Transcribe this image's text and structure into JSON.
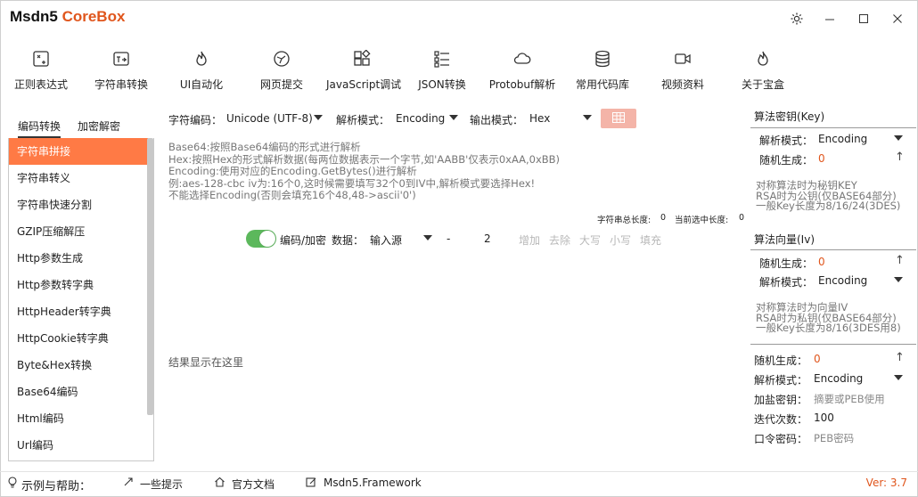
{
  "app": {
    "title_part1": "Msdn5",
    "title_part2": "CoreBox"
  },
  "toolbar": {
    "items": [
      {
        "label": "正则表达式",
        "icon": "regex-icon"
      },
      {
        "label": "字符串转换",
        "icon": "string-convert-icon"
      },
      {
        "label": "UI自动化",
        "icon": "flame-icon"
      },
      {
        "label": "网页提交",
        "icon": "web-submit-icon"
      },
      {
        "label": "JavaScript调试",
        "icon": "blocks-icon"
      },
      {
        "label": "JSON转换",
        "icon": "json-tree-icon"
      },
      {
        "label": "Protobuf解析",
        "icon": "cloud-icon"
      },
      {
        "label": "常用代码库",
        "icon": "database-icon"
      },
      {
        "label": "视频资料",
        "icon": "video-icon"
      },
      {
        "label": "关于宝盒",
        "icon": "flame-icon"
      }
    ]
  },
  "left": {
    "tabs": [
      "编码转换",
      "加密解密"
    ],
    "items": [
      "字符串拼接",
      "字符串转义",
      "字符串快速分割",
      "GZIP压缩解压",
      "Http参数生成",
      "Http参数转字典",
      "HttpHeader转字典",
      "HttpCookie转字典",
      "Byte&Hex转换",
      "Base64编码",
      "Html编码",
      "Url编码"
    ]
  },
  "options": {
    "charset_label": "字符编码：",
    "charset_value": "Unicode (UTF-8)",
    "parse_label": "解析模式：",
    "parse_value": "Encoding",
    "output_label": "输出模式：",
    "output_value": "Hex"
  },
  "hints": [
    "Base64:按照Base64编码的形式进行解析",
    "Hex:按照Hex的形式解析数据(每两位数据表示一个字节,如'AABB'仅表示0xAA,0xBB)",
    "Encoding:使用对应的Encoding.GetBytes()进行解析",
    "例:aes-128-cbc  iv为:16个0,这时候需要填写32个0到IV中,解析模式要选择Hex!",
    "不能选择Encoding(否则会填充16个48,48->ascii'0')"
  ],
  "counters": {
    "total_label": "字符串总长度:",
    "total_value": "0",
    "selected_label": "当前选中长度:",
    "selected_value": "0"
  },
  "data_row": {
    "toggle_label": "编码/加密",
    "data_label": "数据：",
    "source_value": "输入源",
    "dash": "-",
    "count": "2",
    "actions": [
      "增加",
      "去除",
      "大写",
      "小写",
      "填充"
    ]
  },
  "result_placeholder": "结果显示在这里",
  "right": {
    "key_title": "算法密钥(Key)",
    "key_parse_label": "解析模式：",
    "key_parse_value": "Encoding",
    "key_random_label": "随机生成：",
    "key_random_value": "0",
    "key_notes": [
      "对称算法时为秘钥KEY",
      "RSA时为公钥(仅BASE64部分)",
      "一般Key长度为8/16/24(3DES)"
    ],
    "iv_title": "算法向量(Iv)",
    "iv_random_label": "随机生成：",
    "iv_random_value": "0",
    "iv_parse_label": "解析模式：",
    "iv_parse_value": "Encoding",
    "iv_notes": [
      "对称算法时为向量IV",
      "RSA时为私钥(仅BASE64部分)",
      "一般Key长度为8/16(3DES用8)"
    ],
    "salt_random_label": "随机生成：",
    "salt_random_value": "0",
    "salt_parse_label": "解析模式：",
    "salt_parse_value": "Encoding",
    "salt_key_label": "加盐密钥：",
    "salt_key_placeholder": "摘要或PEB使用",
    "iter_label": "迭代次数：",
    "iter_value": "100",
    "pass_label": "口令密码：",
    "pass_placeholder": "PEB密码"
  },
  "footer": {
    "help_label": "示例与帮助：",
    "links": [
      "一些提示",
      "官方文档",
      "Msdn5.Framework"
    ],
    "version": "Ver: 3.7"
  },
  "colors": {
    "accent": "#ff7a45",
    "brand": "#e0561d",
    "toggle": "#5cb85c"
  }
}
